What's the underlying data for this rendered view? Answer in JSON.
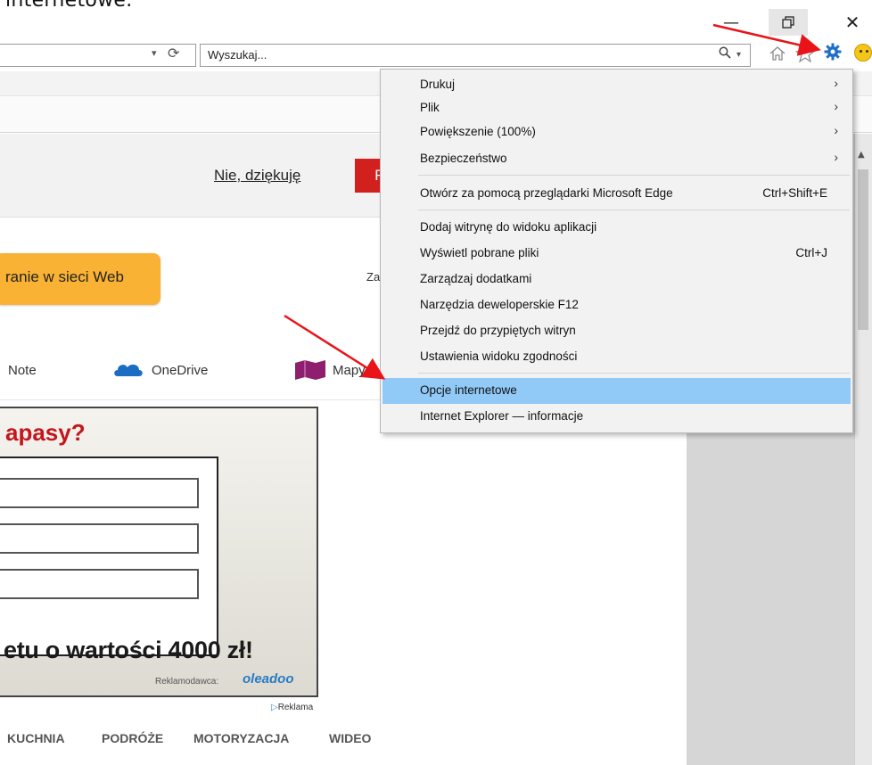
{
  "page_top_text": "internetowe.",
  "address": {
    "dropdown_glyph": "▾",
    "refresh_glyph": "⟳"
  },
  "search": {
    "placeholder": "Wyszukaj...",
    "dropdown_glyph": "▾"
  },
  "banner": {
    "no_thanks": "Nie, dziękuję",
    "red_button_text": "P"
  },
  "web_search_button": "ranie w sieci Web",
  "za_text": "Za",
  "links": {
    "onenote": "Note",
    "onedrive": "OneDrive",
    "mapy": "Mapy"
  },
  "ad": {
    "title": "apasy?",
    "bottom_text": "etu o wartości 4000 zł!",
    "advertiser_label": "Reklamodawca:",
    "advertiser_logo": "oleadoo",
    "reklama_label": "Reklama"
  },
  "categories": [
    "KUCHNIA",
    "PODRÓŻE",
    "MOTORYZACJA",
    "WIDEO"
  ],
  "tools_menu": {
    "items": [
      {
        "label": "Drukuj",
        "shortcut": "",
        "submenu": true
      },
      {
        "label": "Plik",
        "shortcut": "",
        "submenu": true
      },
      {
        "label": "Powiększenie (100%)",
        "shortcut": "",
        "submenu": true
      },
      {
        "label": "Bezpieczeństwo",
        "shortcut": "",
        "submenu": true
      },
      {
        "label": "Otwórz za pomocą przeglądarki Microsoft Edge",
        "shortcut": "Ctrl+Shift+E",
        "submenu": false
      },
      {
        "label": "Dodaj witrynę do widoku aplikacji",
        "shortcut": "",
        "submenu": false
      },
      {
        "label": "Wyświetl pobrane pliki",
        "shortcut": "Ctrl+J",
        "submenu": false
      },
      {
        "label": "Zarządzaj dodatkami",
        "shortcut": "",
        "submenu": false
      },
      {
        "label": "Narzędzia deweloperskie F12",
        "shortcut": "",
        "submenu": false
      },
      {
        "label": "Przejdź do przypiętych witryn",
        "shortcut": "",
        "submenu": false
      },
      {
        "label": "Ustawienia widoku zgodności",
        "shortcut": "",
        "submenu": false
      },
      {
        "label": "Opcje internetowe",
        "shortcut": "",
        "submenu": false,
        "highlighted": true
      },
      {
        "label": "Internet Explorer — informacje",
        "shortcut": "",
        "submenu": false
      }
    ],
    "submenu_arrow": "›"
  },
  "colors": {
    "highlight": "#91c9f7",
    "annotation_arrow": "#e8141a",
    "gear": "#1f6fc8"
  }
}
